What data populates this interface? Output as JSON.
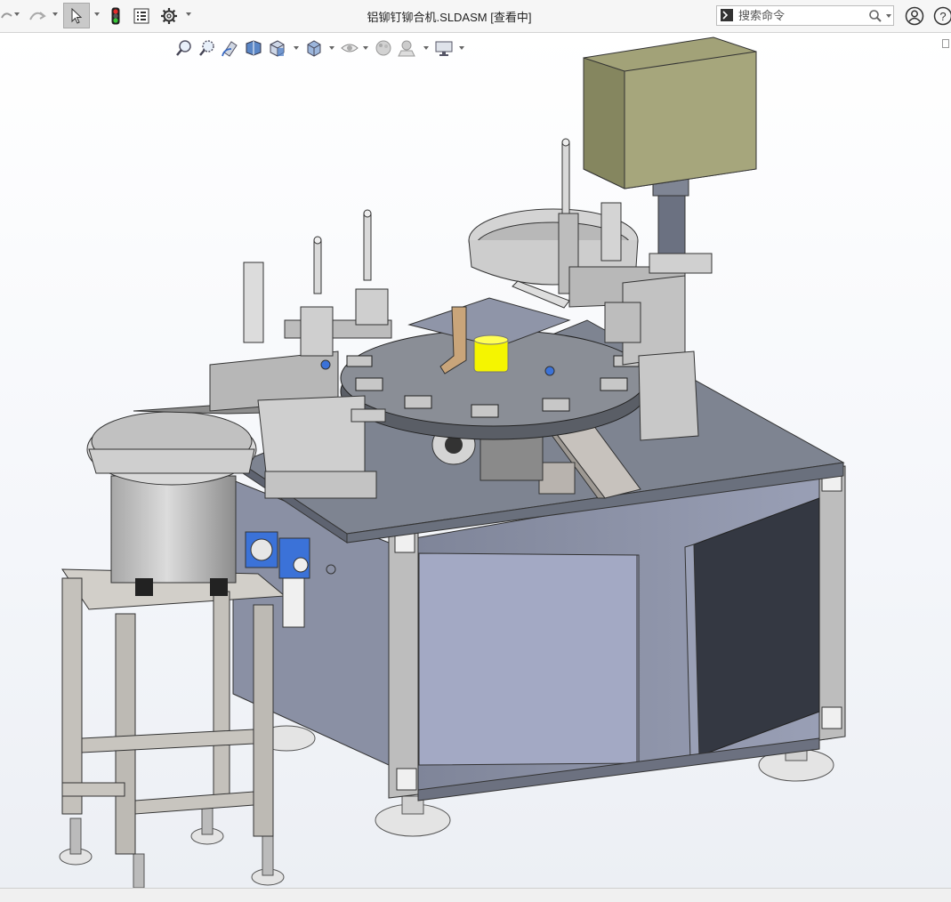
{
  "window": {
    "title": "铝铆钉铆合机.SLDASM [查看中]"
  },
  "toolbar": {
    "undo_icon": "undo-icon",
    "redo_icon": "redo-icon",
    "select_icon": "select-arrow-icon",
    "rebuild_icon": "traffic-light-icon",
    "file_props_icon": "file-properties-icon",
    "options_icon": "gear-icon"
  },
  "search": {
    "placeholder": "搜索命令",
    "icon": "search-icon"
  },
  "account": {
    "user_icon": "user-icon",
    "help_icon": "help-icon",
    "help_label": "?"
  },
  "heads_up_view": {
    "items": [
      "zoom-to-fit-icon",
      "zoom-to-area-icon",
      "previous-view-icon",
      "section-view-icon",
      "view-orientation-icon",
      "display-style-icon",
      "hide-show-items-icon",
      "edit-appearance-icon",
      "apply-scene-icon",
      "view-settings-icon"
    ]
  },
  "colors": {
    "table_top": "#808693",
    "cabinet": "#8e94a8",
    "door_open": "#a3a9c4",
    "frame": "#b9b9b9",
    "stand": "#c8c5bf",
    "control_box": "#a2a278",
    "marker_yellow": "#f5f500",
    "pneumatic_blue": "#3b72d8"
  }
}
